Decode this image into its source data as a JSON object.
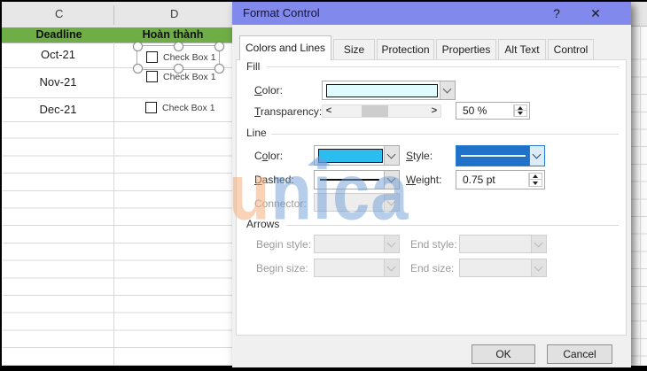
{
  "spreadsheet": {
    "columns": {
      "c": "C",
      "d": "D"
    },
    "header": {
      "deadline": "Deadline",
      "hoan_thanh": "Hoàn thành"
    },
    "rows": [
      {
        "deadline": "Oct-21",
        "checkbox_label": "Check Box 1",
        "selected": true
      },
      {
        "deadline": "Nov-21",
        "checkbox_label": "Check Box 1",
        "selected": false
      },
      {
        "deadline": "Dec-21",
        "checkbox_label": "Check Box 1",
        "selected": false
      }
    ]
  },
  "dialog": {
    "title": "Format Control",
    "help_label": "?",
    "close_label": "✕",
    "tabs": [
      "Colors and Lines",
      "Size",
      "Protection",
      "Properties",
      "Alt Text",
      "Control"
    ],
    "fill": {
      "section_label": "Fill",
      "color_label": {
        "key": "C",
        "rest": "olor:"
      },
      "transparency_label": {
        "key": "T",
        "rest": "ransparency:"
      },
      "transparency_value": "50 %",
      "scroll_left_icon": "<",
      "scroll_right_icon": ">"
    },
    "line": {
      "section_label": "Line",
      "color_label": {
        "pre": "C",
        "key": "o",
        "rest": "lor:"
      },
      "style_label": {
        "key": "S",
        "rest": "tyle:"
      },
      "dashed_label": {
        "key": "D",
        "rest": "ashed:"
      },
      "weight_label": {
        "key": "W",
        "rest": "eight:"
      },
      "connector_label": "Connector:",
      "weight_value": "0.75 pt"
    },
    "arrows": {
      "section_label": "Arrows",
      "begin_style_label": "Begin style:",
      "end_style_label": "End style:",
      "begin_size_label": "Begin size:",
      "end_size_label": "End size:"
    },
    "buttons": {
      "ok": "OK",
      "cancel": "Cancel"
    }
  },
  "watermark": {
    "first_letter": "u",
    "rest": "nica"
  },
  "colors": {
    "titlebar": "#8289ec",
    "header_green": "#6fad47",
    "fill_swatch": "#defbfd",
    "line_color_swatch": "#2bbdf0",
    "style_preview": "#1f72c8",
    "watermark_blue": "#709dd8",
    "watermark_orange": "#f2ae7e"
  }
}
